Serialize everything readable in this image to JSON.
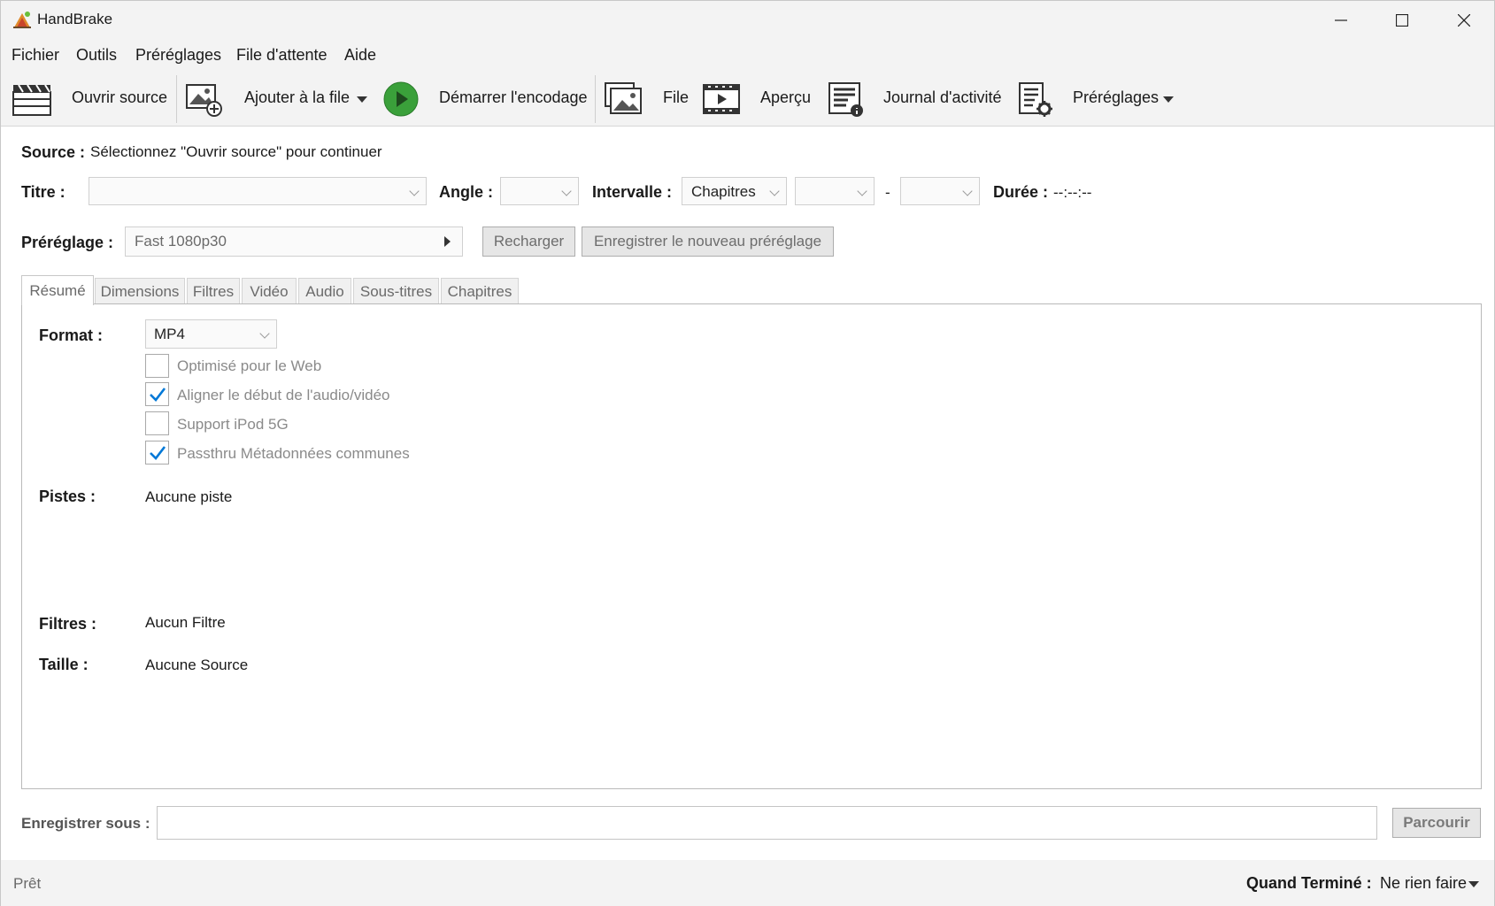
{
  "window": {
    "title": "HandBrake"
  },
  "menu": [
    "Fichier",
    "Outils",
    "Préréglages",
    "File d'attente",
    "Aide"
  ],
  "toolbar": {
    "open_source": "Ouvrir source",
    "add_to_queue": "Ajouter à la file",
    "start_encode": "Démarrer l'encodage",
    "queue": "File",
    "preview": "Aperçu",
    "activity_log": "Journal d'activité",
    "presets": "Préréglages"
  },
  "source": {
    "label": "Source :",
    "value": "Sélectionnez \"Ouvrir source\" pour continuer"
  },
  "title_row": {
    "title_label": "Titre :",
    "title_value": "",
    "angle_label": "Angle :",
    "angle_value": "",
    "range_label": "Intervalle :",
    "range_mode": "Chapitres",
    "range_start": "",
    "range_sep": "-",
    "range_end": "",
    "duration_label": "Durée :",
    "duration_value": "--:--:--"
  },
  "preset_row": {
    "label": "Préréglage :",
    "value": "Fast 1080p30",
    "reload": "Recharger",
    "save_new": "Enregistrer le nouveau préréglage"
  },
  "tabs": [
    "Résumé",
    "Dimensions",
    "Filtres",
    "Vidéo",
    "Audio",
    "Sous-titres",
    "Chapitres"
  ],
  "active_tab": "Résumé",
  "summary": {
    "format_label": "Format :",
    "format_value": "MP4",
    "options": [
      {
        "label": "Optimisé pour le Web",
        "checked": false
      },
      {
        "label": "Aligner le début de l'audio/vidéo",
        "checked": true
      },
      {
        "label": "Support iPod 5G",
        "checked": false
      },
      {
        "label": "Passthru Métadonnées communes",
        "checked": true
      }
    ],
    "tracks_label": "Pistes :",
    "tracks_value": "Aucune piste",
    "filters_label": "Filtres :",
    "filters_value": "Aucun Filtre",
    "size_label": "Taille :",
    "size_value": "Aucune Source"
  },
  "save_as": {
    "label": "Enregistrer sous :",
    "value": "",
    "browse": "Parcourir"
  },
  "status": {
    "text": "Prêt",
    "when_done_label": "Quand Terminé :",
    "when_done_value": "Ne rien faire"
  },
  "colors": {
    "accent": "#0078d7",
    "play_green": "#3aa03a"
  }
}
